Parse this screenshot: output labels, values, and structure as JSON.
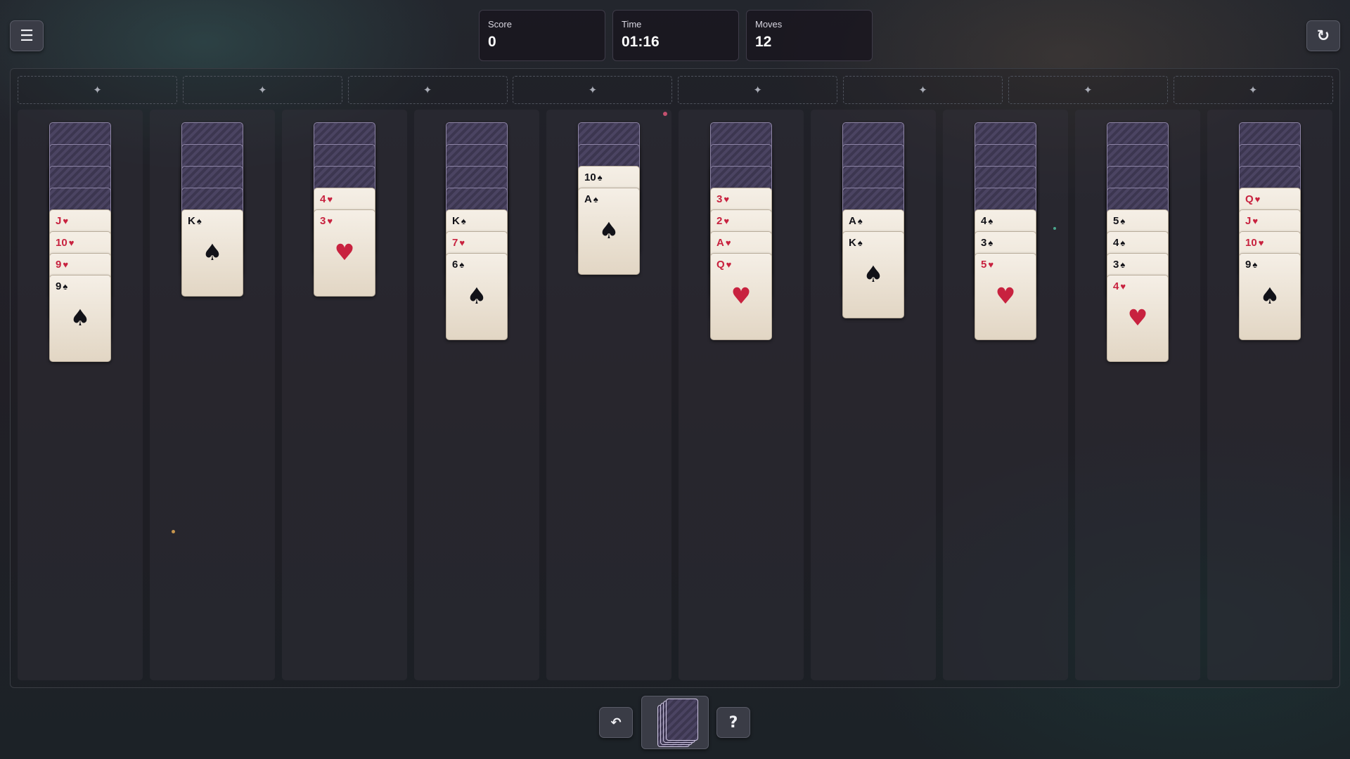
{
  "header": {
    "menu_icon": "☰",
    "restart_icon": "↻",
    "stats": [
      {
        "label": "Score",
        "value": "0"
      },
      {
        "label": "Time",
        "value": "01:16"
      },
      {
        "label": "Moves",
        "value": "12"
      }
    ]
  },
  "foundation": {
    "slot_icon": "✦",
    "count": 8
  },
  "colors": {
    "red_suit": "#c8223f",
    "black_suit": "#121218"
  },
  "tableau": [
    {
      "face_down": 4,
      "face_up": [
        {
          "rank": "J",
          "suit": "♥"
        },
        {
          "rank": "10",
          "suit": "♥"
        },
        {
          "rank": "9",
          "suit": "♥"
        },
        {
          "rank": "9",
          "suit": "♠"
        }
      ]
    },
    {
      "face_down": 4,
      "face_up": [
        {
          "rank": "K",
          "suit": "♠"
        }
      ]
    },
    {
      "face_down": 3,
      "face_up": [
        {
          "rank": "4",
          "suit": "♥"
        },
        {
          "rank": "3",
          "suit": "♥"
        }
      ]
    },
    {
      "face_down": 4,
      "face_up": [
        {
          "rank": "K",
          "suit": "♠"
        },
        {
          "rank": "7",
          "suit": "♥"
        },
        {
          "rank": "6",
          "suit": "♠"
        }
      ]
    },
    {
      "face_down": 2,
      "face_up": [
        {
          "rank": "10",
          "suit": "♠"
        },
        {
          "rank": "A",
          "suit": "♠"
        }
      ]
    },
    {
      "face_down": 3,
      "face_up": [
        {
          "rank": "3",
          "suit": "♥"
        },
        {
          "rank": "2",
          "suit": "♥"
        },
        {
          "rank": "A",
          "suit": "♥"
        },
        {
          "rank": "Q",
          "suit": "♥"
        }
      ]
    },
    {
      "face_down": 4,
      "face_up": [
        {
          "rank": "A",
          "suit": "♠"
        },
        {
          "rank": "K",
          "suit": "♠"
        }
      ]
    },
    {
      "face_down": 4,
      "face_up": [
        {
          "rank": "4",
          "suit": "♠"
        },
        {
          "rank": "3",
          "suit": "♠"
        },
        {
          "rank": "5",
          "suit": "♥"
        }
      ]
    },
    {
      "face_down": 4,
      "face_up": [
        {
          "rank": "5",
          "suit": "♠"
        },
        {
          "rank": "4",
          "suit": "♠"
        },
        {
          "rank": "3",
          "suit": "♠"
        },
        {
          "rank": "4",
          "suit": "♥"
        }
      ]
    },
    {
      "face_down": 3,
      "face_up": [
        {
          "rank": "Q",
          "suit": "♥"
        },
        {
          "rank": "J",
          "suit": "♥"
        },
        {
          "rank": "10",
          "suit": "♥"
        },
        {
          "rank": "9",
          "suit": "♠"
        }
      ]
    }
  ],
  "footer": {
    "undo_icon": "↶",
    "hint_icon": "?"
  }
}
